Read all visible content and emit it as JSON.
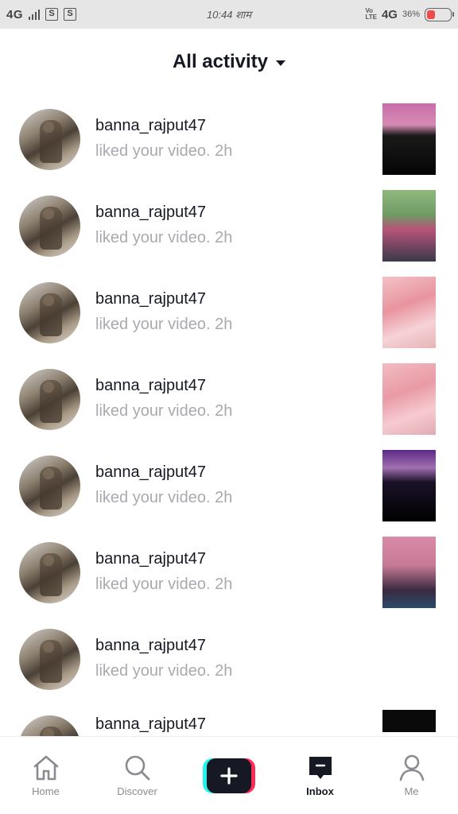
{
  "status_bar": {
    "network": "4G",
    "sim_icon_1": "S",
    "sim_icon_2": "S",
    "time": "10:44 शाम",
    "volte_top": "Vo",
    "volte_bottom": "LTE",
    "network_right": "4G",
    "battery_percent": "36%",
    "battery_level": 0.36
  },
  "header": {
    "title": "All activity",
    "dropdown_icon": "caret-down-icon"
  },
  "activity": [
    {
      "username": "banna_rajput47",
      "action": "liked your video.",
      "time": "2h"
    },
    {
      "username": "banna_rajput47",
      "action": "liked your video.",
      "time": "2h"
    },
    {
      "username": "banna_rajput47",
      "action": "liked your video.",
      "time": "2h"
    },
    {
      "username": "banna_rajput47",
      "action": "liked your video.",
      "time": "2h"
    },
    {
      "username": "banna_rajput47",
      "action": "liked your video.",
      "time": "2h"
    },
    {
      "username": "banna_rajput47",
      "action": "liked your video.",
      "time": "2h"
    },
    {
      "username": "banna_rajput47",
      "action": "liked your video.",
      "time": "2h"
    },
    {
      "username": "banna_rajput47",
      "action": "",
      "time": ""
    }
  ],
  "nav": {
    "home": "Home",
    "discover": "Discover",
    "create": "+",
    "inbox": "Inbox",
    "me": "Me"
  },
  "colors": {
    "text_primary": "#161823",
    "text_secondary": "#a9aab0",
    "accent_cyan": "#25f4ee",
    "accent_red": "#fe2c55"
  }
}
